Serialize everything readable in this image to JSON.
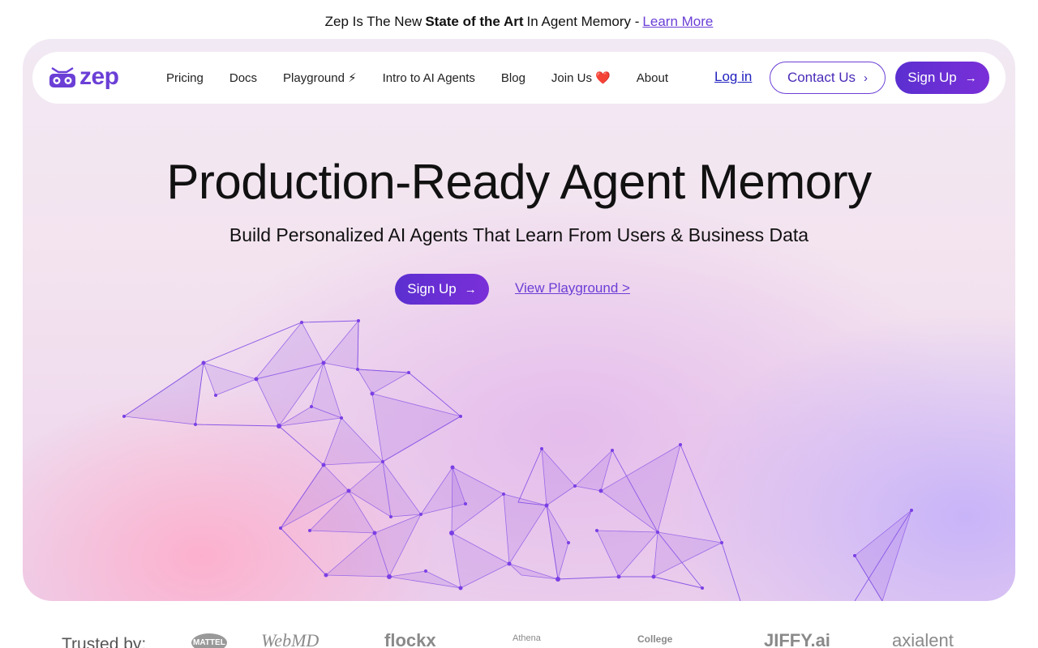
{
  "announcement": {
    "prefix": "Zep Is The New",
    "bold": "State of the Art",
    "suffix": "In Agent Memory -",
    "link": "Learn More"
  },
  "logo": {
    "text": "zep",
    "icon": "robot-icon"
  },
  "nav": {
    "items": [
      "Pricing",
      "Docs",
      "Playground ⚡",
      "Intro to AI Agents",
      "Blog",
      "Join Us ❤️",
      "About"
    ],
    "login": "Log in",
    "contact": "Contact Us",
    "signup": "Sign Up"
  },
  "hero": {
    "title": "Production-Ready Agent Memory",
    "subtitle": "Build Personalized AI Agents That Learn From Users & Business Data",
    "cta_primary": "Sign Up",
    "cta_secondary": "View Playground >"
  },
  "trusted": {
    "label": "Trusted by:",
    "brands": [
      "MATTEL",
      "WebMD",
      "flockx",
      "Athena",
      "College",
      "JIFFY.ai",
      "axialent"
    ]
  },
  "colors": {
    "accent": "#6b3fd6",
    "accent_dark": "#5b2fd0",
    "link": "#1f1fbf"
  }
}
